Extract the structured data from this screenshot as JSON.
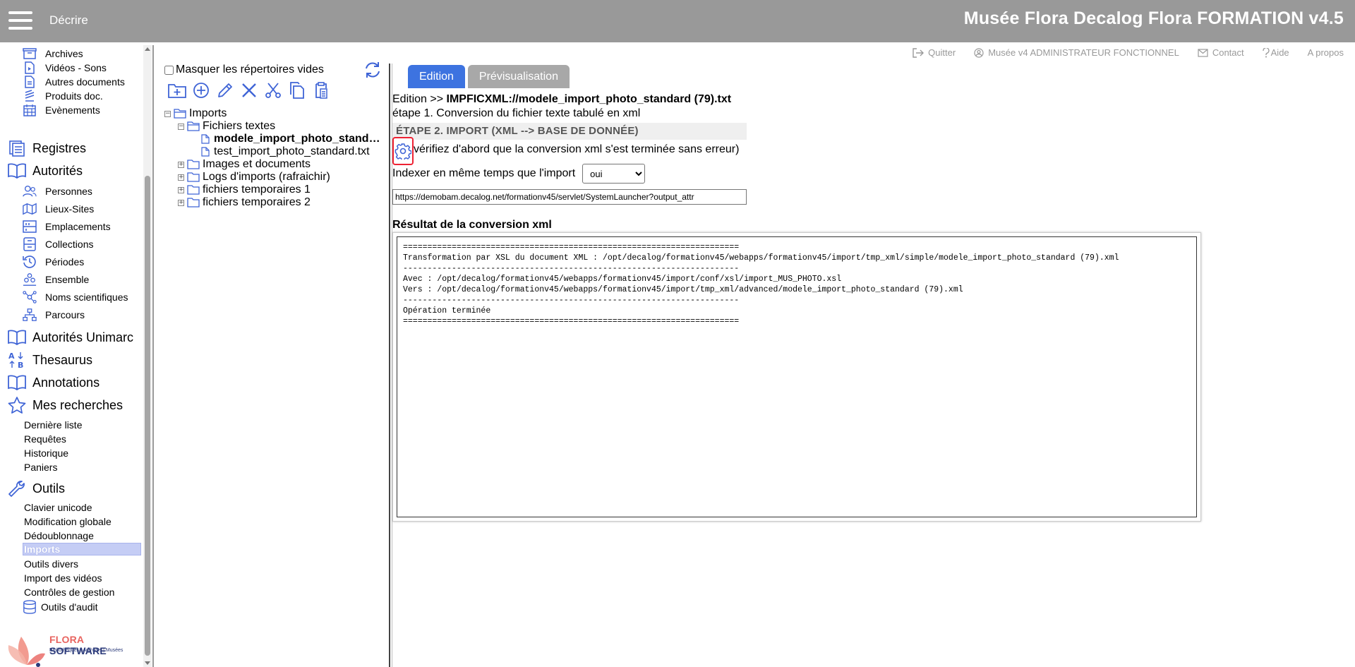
{
  "header": {
    "menu_label": "Décrire",
    "app_title": "Musée Flora Decalog Flora FORMATION v4.5"
  },
  "top_links": [
    {
      "label": "Quitter",
      "icon": "exit-icon"
    },
    {
      "label": "Musée v4 ADMINISTRATEUR FONCTIONNEL",
      "icon": "user-icon"
    },
    {
      "label": "Contact",
      "icon": "mail-icon"
    },
    {
      "label": "Aide",
      "icon": "question-icon"
    },
    {
      "label": "A propos",
      "icon": ""
    }
  ],
  "sidebar": {
    "sub_top": [
      "Archives",
      "Vidéos - Sons",
      "Autres documents",
      "Produits doc.",
      "Evènements"
    ],
    "registres": "Registres",
    "autorites": "Autorités",
    "autorites_items": [
      "Personnes",
      "Lieux-Sites",
      "Emplacements",
      "Collections",
      "Périodes",
      "Ensemble",
      "Noms scientifiques",
      "Parcours"
    ],
    "autorites_unimarc": "Autorités Unimarc",
    "thesaurus": "Thesaurus",
    "annotations": "Annotations",
    "mes_recherches": "Mes recherches",
    "mes_recherches_items": [
      "Dernière liste",
      "Requêtes",
      "Historique",
      "Paniers"
    ],
    "outils": "Outils",
    "outils_items": [
      "Clavier unicode",
      "Modification globale",
      "Dédoublonnage",
      "Imports",
      "Outils divers",
      "Import des vidéos",
      "Contrôles de gestion"
    ],
    "outils_audit": "Outils d'audit",
    "active_item": "Imports",
    "logo_name_a": "FLORA",
    "logo_name_b": "SOFTWARE",
    "logo_tagline": "Bibliothèques | Archives | Musées"
  },
  "tree_panel": {
    "hide_empty_label": "Masquer les répertoires vides",
    "hide_empty_checked": false,
    "nodes": {
      "imports": "Imports",
      "fichiers_textes": "Fichiers textes",
      "file1": "modele_import_photo_standard (79).txt",
      "file2": "test_import_photo_standard.txt",
      "images": "Images et documents",
      "logs": "Logs d'imports (rafraichir)",
      "tmp1": "fichiers temporaires 1",
      "tmp2": "fichiers temporaires 2"
    }
  },
  "tabs": {
    "edition": "Edition",
    "preview": "Prévisualisation"
  },
  "main": {
    "crumb_prefix": "Edition >> ",
    "crumb_file": "IMPFICXML://modele_import_photo_standard (79).txt",
    "step1": "étape 1. Conversion du fichier texte tabulé en xml",
    "step2": "ÉTAPE 2. IMPORT (XML --> BASE DE DONNÉE)",
    "verify_text": "vérifiez d'abord que la conversion xml s'est terminée sans erreur)",
    "index_label": "Indexer en même temps que l'import",
    "index_value": "oui",
    "url_value": "https://demobam.decalog.net/formationv45/servlet/SystemLauncher?output_attr",
    "result_title": "Résultat de la conversion xml",
    "result_text": "=====================================================================\nTransformation par XSL du document XML : /opt/decalog/formationv45/webapps/formationv45/import/tmp_xml/simple/modele_import_photo_standard (79).xml\n---------------------------------------------------------------------\nAvec : /opt/decalog/formationv45/webapps/formationv45/import/conf/xsl/import_MUS_PHOTO.xsl\nVers : /opt/decalog/formationv45/webapps/formationv45/import/tmp_xml/advanced/modele_import_photo_standard (79).xml\n---------------------------------------------------------------------\nOpération terminée\n====================================================================="
  },
  "colors": {
    "header_bg": "#999999",
    "accent": "#3d73e0",
    "icon_blue": "#3f64d6"
  }
}
